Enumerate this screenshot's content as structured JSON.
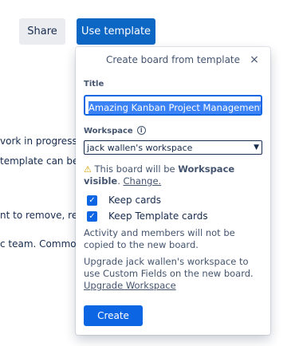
{
  "background": {
    "lines": [
      "vork in progress or",
      "template can be us",
      "nt to remove, renai",
      "c team. Common o"
    ]
  },
  "header": {
    "share_label": "Share",
    "use_template_label": "Use template"
  },
  "popover": {
    "title": "Create board from template",
    "close_glyph": "×",
    "title_label": "Title",
    "title_value": "Amazing Kanban Project Management",
    "workspace_label": "Workspace",
    "info_glyph": "i",
    "workspace_value": "jack wallen's workspace",
    "warning_glyph": "⚠",
    "visibility_prefix": " This board will be ",
    "visibility_bold": "Workspace visible",
    "visibility_suffix": ".",
    "change_link": "Change.",
    "checkboxes": [
      {
        "label": "Keep cards",
        "checked": true
      },
      {
        "label": "Keep Template cards",
        "checked": true
      }
    ],
    "check_glyph": "✓",
    "note_activity": "Activity and members will not be copied to the new board.",
    "upgrade_text": "Upgrade jack wallen's workspace to use Custom Fields on the new board. ",
    "upgrade_link": "Upgrade Workspace",
    "create_label": "Create"
  },
  "colors": {
    "primary": "#0c66e4",
    "use_template_bg": "#0c66c4",
    "selection": "#3b82f6",
    "warning": "#d6a000"
  }
}
